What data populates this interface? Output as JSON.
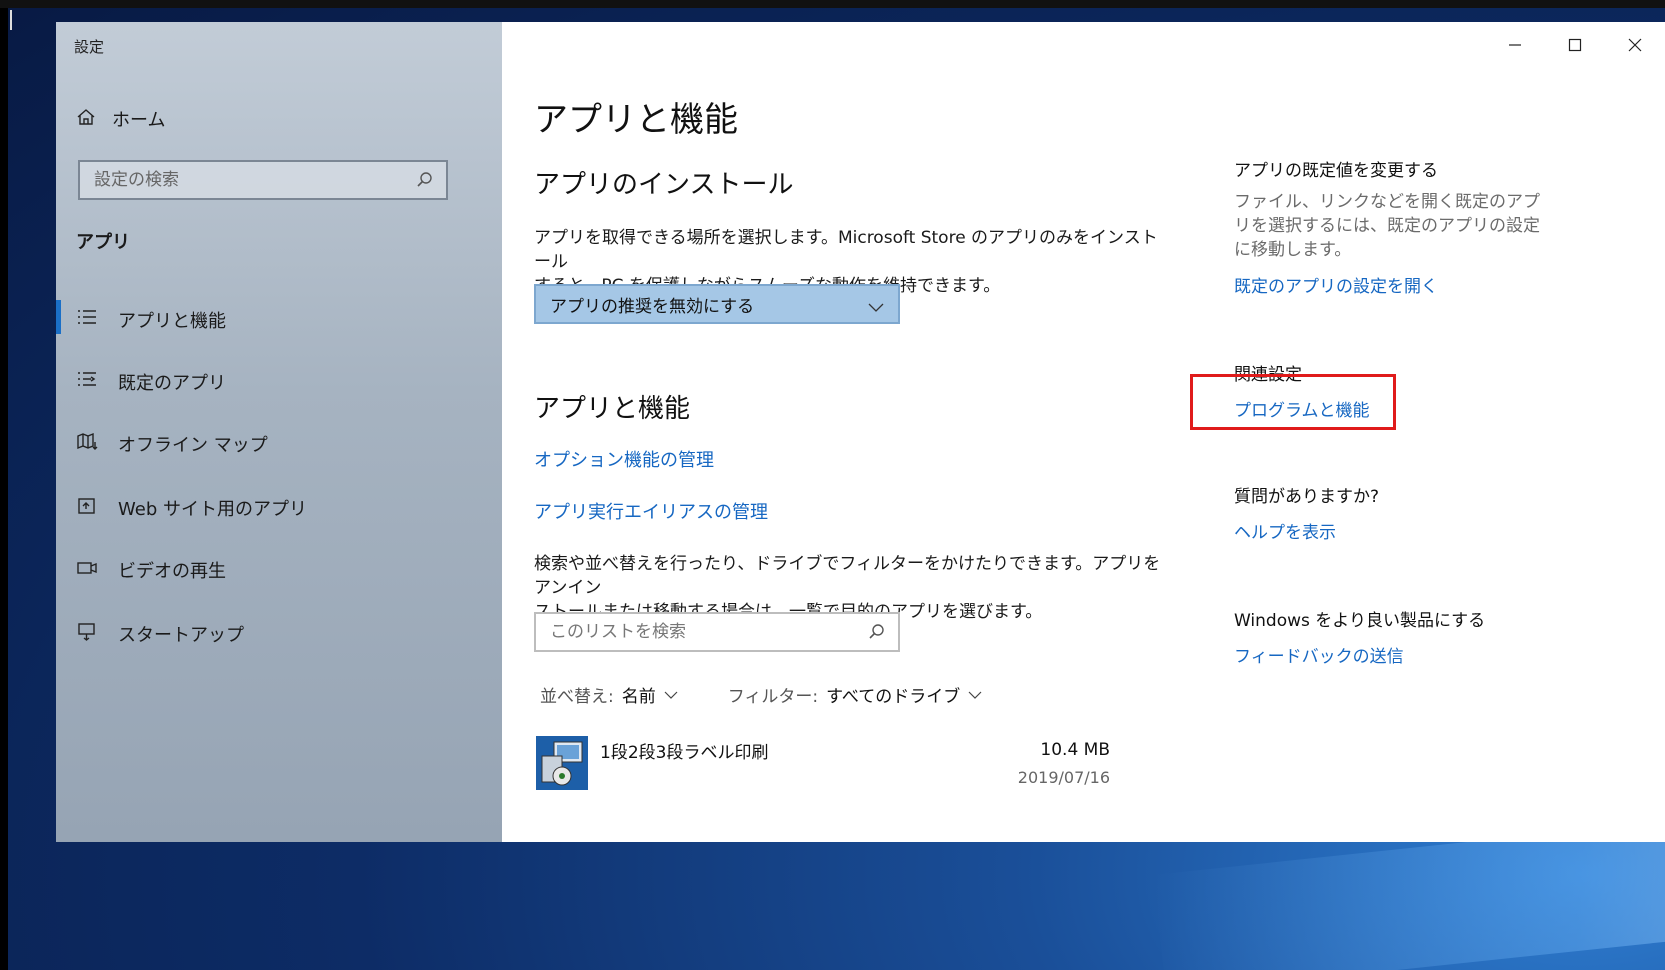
{
  "window": {
    "title": "設定"
  },
  "sidebar": {
    "home_label": "ホーム",
    "search_placeholder": "設定の検索",
    "section_title": "アプリ",
    "items": [
      {
        "label": "アプリと機能",
        "icon": "list-icon",
        "active": true
      },
      {
        "label": "既定のアプリ",
        "icon": "default-apps-icon",
        "active": false
      },
      {
        "label": "オフライン マップ",
        "icon": "map-icon",
        "active": false
      },
      {
        "label": "Web サイト用のアプリ",
        "icon": "open-in-app-icon",
        "active": false
      },
      {
        "label": "ビデオの再生",
        "icon": "video-icon",
        "active": false
      },
      {
        "label": "スタートアップ",
        "icon": "startup-icon",
        "active": false
      }
    ]
  },
  "main": {
    "page_title": "アプリと機能",
    "install": {
      "heading": "アプリのインストール",
      "desc_line1": "アプリを取得できる場所を選択します。Microsoft Store のアプリのみをインストール",
      "desc_line2": "すると、PC を保護しながらスムーズな動作を維持できます。",
      "dropdown_value": "アプリの推奨を無効にする"
    },
    "features": {
      "heading": "アプリと機能",
      "link_optional": "オプション機能の管理",
      "link_alias": "アプリ実行エイリアスの管理",
      "desc_line1": "検索や並べ替えを行ったり、ドライブでフィルターをかけたりできます。アプリをアンイン",
      "desc_line2": "ストールまたは移動する場合は、一覧で目的のアプリを選びます。",
      "search_placeholder": "このリストを検索",
      "sort_label": "並べ替え:",
      "sort_value": "名前",
      "filter_label": "フィルター:",
      "filter_value": "すべてのドライブ"
    },
    "apps": [
      {
        "name": "1段2段3段ラベル印刷",
        "size": "10.4 MB",
        "date": "2019/07/16"
      }
    ]
  },
  "right": {
    "defaults_heading": "アプリの既定値を変更する",
    "defaults_text": "ファイル、リンクなどを開く既定のアプリを選択するには、既定のアプリの設定に移動します。",
    "defaults_link": "既定のアプリの設定を開く",
    "related_heading": "関連設定",
    "related_link": "プログラムと機能",
    "question_heading": "質問がありますか?",
    "help_link": "ヘルプを表示",
    "feedback_heading": "Windows をより良い製品にする",
    "feedback_link": "フィードバックの送信"
  },
  "colors": {
    "accent": "#1667c2",
    "highlight": "#e01b1b",
    "dropdown_bg": "#a5c7e6"
  }
}
